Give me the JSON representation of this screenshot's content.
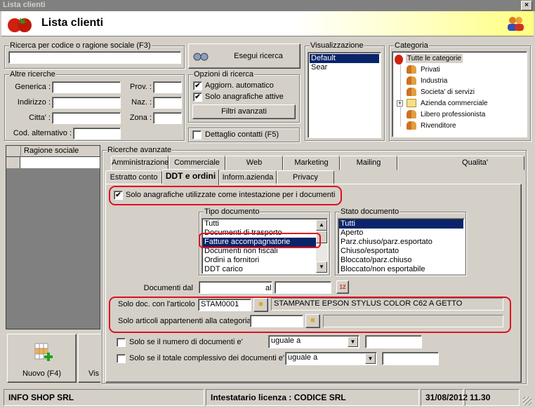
{
  "window": {
    "title": "Lista clienti",
    "close": "×"
  },
  "header": {
    "title": "Lista clienti"
  },
  "search": {
    "group_label": "Ricerca per codice o ragione sociale (F3)",
    "value": "",
    "button": "Esegui ricerca"
  },
  "other": {
    "group_label": "Altre ricerche",
    "generica": "Generica :",
    "indirizzo": "Indirizzo :",
    "citta": "Citta' :",
    "cod_alt": "Cod. alternativo :",
    "prov": "Prov. :",
    "naz": "Naz. :",
    "zona": "Zona :"
  },
  "options": {
    "group_label": "Opzioni di ricerca",
    "auto_update": "Aggiorn. automatico",
    "auto_update_checked": true,
    "active_only": "Solo anagrafiche attive",
    "active_only_checked": true,
    "advanced": "Filtri avanzati",
    "contacts": "Dettaglio contatti (F5)",
    "contacts_checked": false
  },
  "view": {
    "group_label": "Visualizzazione",
    "items": [
      "Default",
      "Sear"
    ],
    "selected": "Default"
  },
  "category": {
    "group_label": "Categoria",
    "root": "Tutte le categorie",
    "items": [
      "Privati",
      "Industria",
      "Societa' di servizi",
      "Azienda commerciale",
      "Libero professionista",
      "Rivenditore"
    ]
  },
  "grid": {
    "column": "Ragione sociale"
  },
  "buttons": {
    "new": "Nuovo (F4)",
    "view": "Vis"
  },
  "advanced": {
    "group_label": "Ricerche avanzate",
    "tabs_row1": [
      "Amministrazione",
      "Commerciale",
      "Web",
      "Marketing",
      "Mailing",
      "Qualita'"
    ],
    "tabs_row2": [
      "Estratto conto",
      "DDT e ordini",
      "Inform.azienda",
      "Privacy"
    ],
    "active_tab": "DDT e ordini",
    "only_header": "Solo anagrafiche utilizzate come intestazione per i documenti",
    "only_header_checked": true,
    "doc_type": {
      "label": "Tipo documento",
      "items": [
        "Tutti",
        "Documenti di trasporto",
        "Fatture accompagnatorie",
        "Documenti non fiscali",
        "Ordini a fornitori",
        "DDT carico"
      ],
      "selected": "Fatture accompagnatorie"
    },
    "doc_state": {
      "label": "Stato documento",
      "items": [
        "Tutti",
        "Aperto",
        "Parz.chiuso/parz.esportato",
        "Chiuso/esportato",
        "Bloccato/parz.chiuso",
        "Bloccato/non esportabile"
      ],
      "selected": "Tutti"
    },
    "date_from": "Documenti dal",
    "date_to": "al",
    "date_from_value": "",
    "date_to_value": "",
    "article_label": "Solo doc. con l'articolo",
    "article_code": "STAM0001",
    "article_desc": "STAMPANTE EPSON STYLUS COLOR C62 A GETTO",
    "category_label": "Solo articoli appartenenti alla categoria",
    "category_code": "",
    "category_desc": "",
    "count_label": "Solo se il numero di documenti e'",
    "count_op": "uguale a",
    "count_value": "",
    "total_label": "Solo se il totale complessivo dei documenti e'",
    "total_op": "uguale a",
    "total_value": ""
  },
  "status": {
    "company": "INFO SHOP SRL",
    "license": "Intestatario licenza : CODICE SRL",
    "date": "31/08/2012",
    "time": "11.30"
  },
  "colors": {
    "selection": "#0a246a",
    "highlight": "#e01020",
    "face": "#d4d0c8"
  }
}
